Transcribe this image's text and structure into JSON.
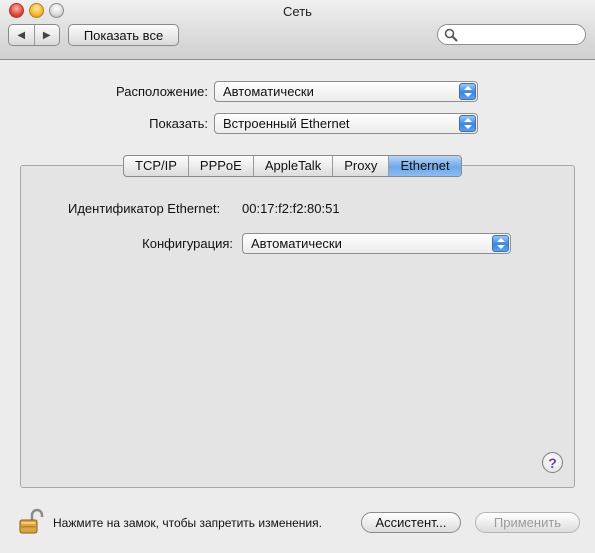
{
  "window": {
    "title": "Сеть"
  },
  "toolbar": {
    "back_glyph": "◀",
    "forward_glyph": "▶",
    "show_all_label": "Показать все",
    "search_placeholder": "",
    "search_value": ""
  },
  "location": {
    "label": "Расположение:",
    "value": "Автоматически"
  },
  "show": {
    "label": "Показать:",
    "value": "Встроенный Ethernet"
  },
  "tabs": [
    {
      "label": "TCP/IP",
      "active": false
    },
    {
      "label": "PPPoE",
      "active": false
    },
    {
      "label": "AppleTalk",
      "active": false
    },
    {
      "label": "Proxy",
      "active": false
    },
    {
      "label": "Ethernet",
      "active": true
    }
  ],
  "ethernet": {
    "id_label": "Идентификатор Ethernet:",
    "id_value": "00:17:f2:f2:80:51",
    "config_label": "Конфигурация:",
    "config_value": "Автоматически"
  },
  "footer": {
    "help_glyph": "?",
    "lock_text": "Нажмите на замок, чтобы запретить изменения.",
    "assistant_label": "Ассистент...",
    "apply_label": "Применить"
  },
  "colors": {
    "accent": "#3b86e0",
    "help_purple": "#6b3fa6",
    "lock_gold": "#d9a441"
  },
  "icons": [
    "search-icon",
    "lock-icon",
    "help-icon",
    "back-icon",
    "forward-icon"
  ]
}
